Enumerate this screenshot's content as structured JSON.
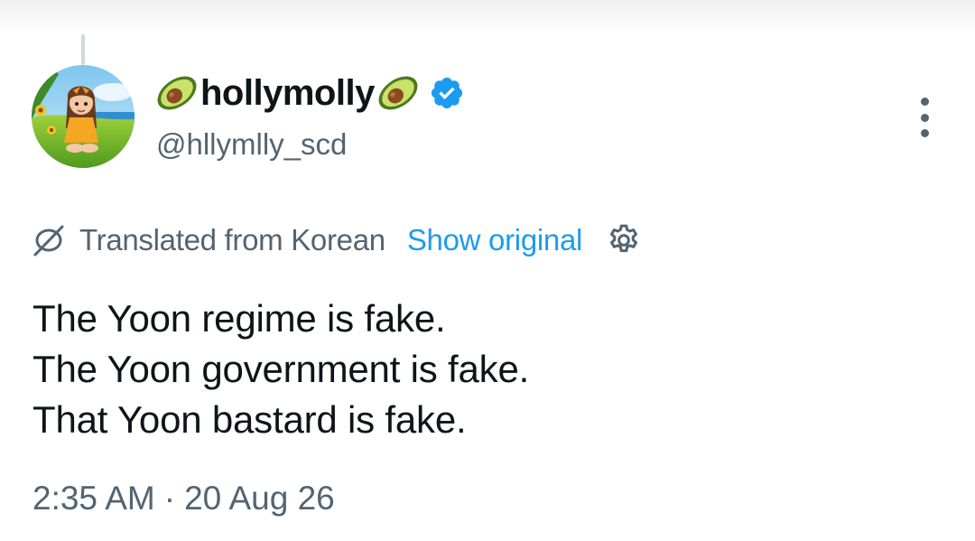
{
  "author": {
    "display_name": "hollymolly",
    "handle": "@hllymlly_scd",
    "name_emoji": "avocado-icon",
    "verified_badge": "verified-icon"
  },
  "translation": {
    "label": "Translated from Korean",
    "show_original_label": "Show original"
  },
  "tweet": {
    "lines": [
      "The Yoon regime is fake.",
      "The Yoon government is fake.",
      "That Yoon bastard is fake."
    ]
  },
  "meta": {
    "time": "2:35 AM",
    "separator": "·",
    "date": "20 Aug 26"
  },
  "colors": {
    "text_primary": "#0f1419",
    "text_secondary": "#536471",
    "accent": "#1d9bf0"
  }
}
